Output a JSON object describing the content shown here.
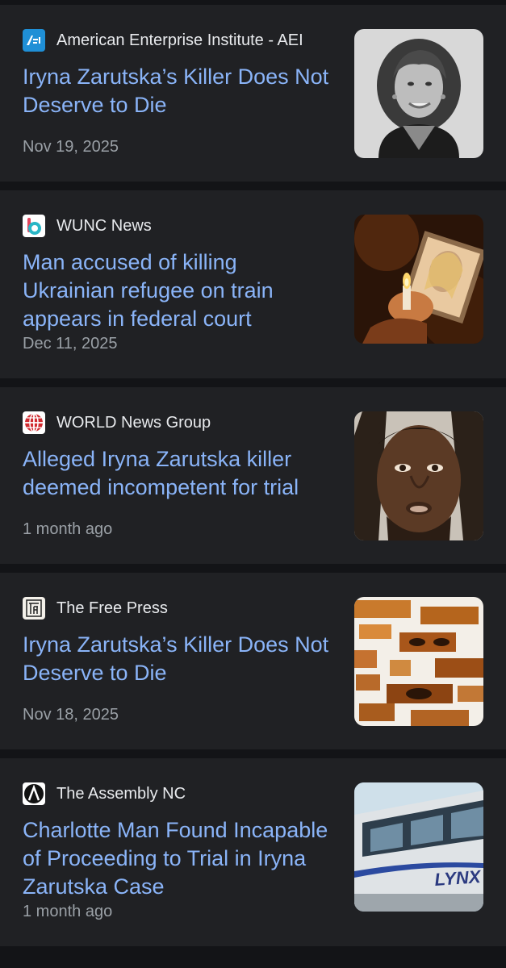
{
  "articles": [
    {
      "source": "American Enterprise Institute - AEI",
      "favicon": "aei-logo-icon",
      "title": "Iryna Zarutska’s Killer Does Not Deserve to Die",
      "date": "Nov 19, 2025",
      "thumbnail": "portrait-photo"
    },
    {
      "source": "WUNC News",
      "favicon": "wunc-logo-icon",
      "title": "Man accused of killing Ukrainian refugee on train appears in federal court",
      "date": "Dec 11, 2025",
      "thumbnail": "candle-vigil-photo"
    },
    {
      "source": "WORLD News Group",
      "favicon": "world-logo-icon",
      "title": "Alleged Iryna Zarutska killer deemed incompetent for trial",
      "date": "1 month ago",
      "thumbnail": "mugshot-photo"
    },
    {
      "source": "The Free Press",
      "favicon": "tfp-logo-icon",
      "title": "Iryna Zarutska’s Killer Does Not Deserve to Die",
      "date": "Nov 18, 2025",
      "thumbnail": "collage-photo"
    },
    {
      "source": "The Assembly NC",
      "favicon": "assembly-logo-icon",
      "title": "Charlotte Man Found Incapable of Proceeding to Trial in Iryna Zarutska Case",
      "date": "1 month ago",
      "thumbnail": "lynx-train-photo"
    }
  ],
  "thumbnail_texts": {
    "train_logo": "LYNX"
  },
  "colors": {
    "page_background": "#131417",
    "card_background": "#202124",
    "headline": "#8ab4f8",
    "source_text": "#e8eaed",
    "date_text": "#9aa0a6"
  }
}
